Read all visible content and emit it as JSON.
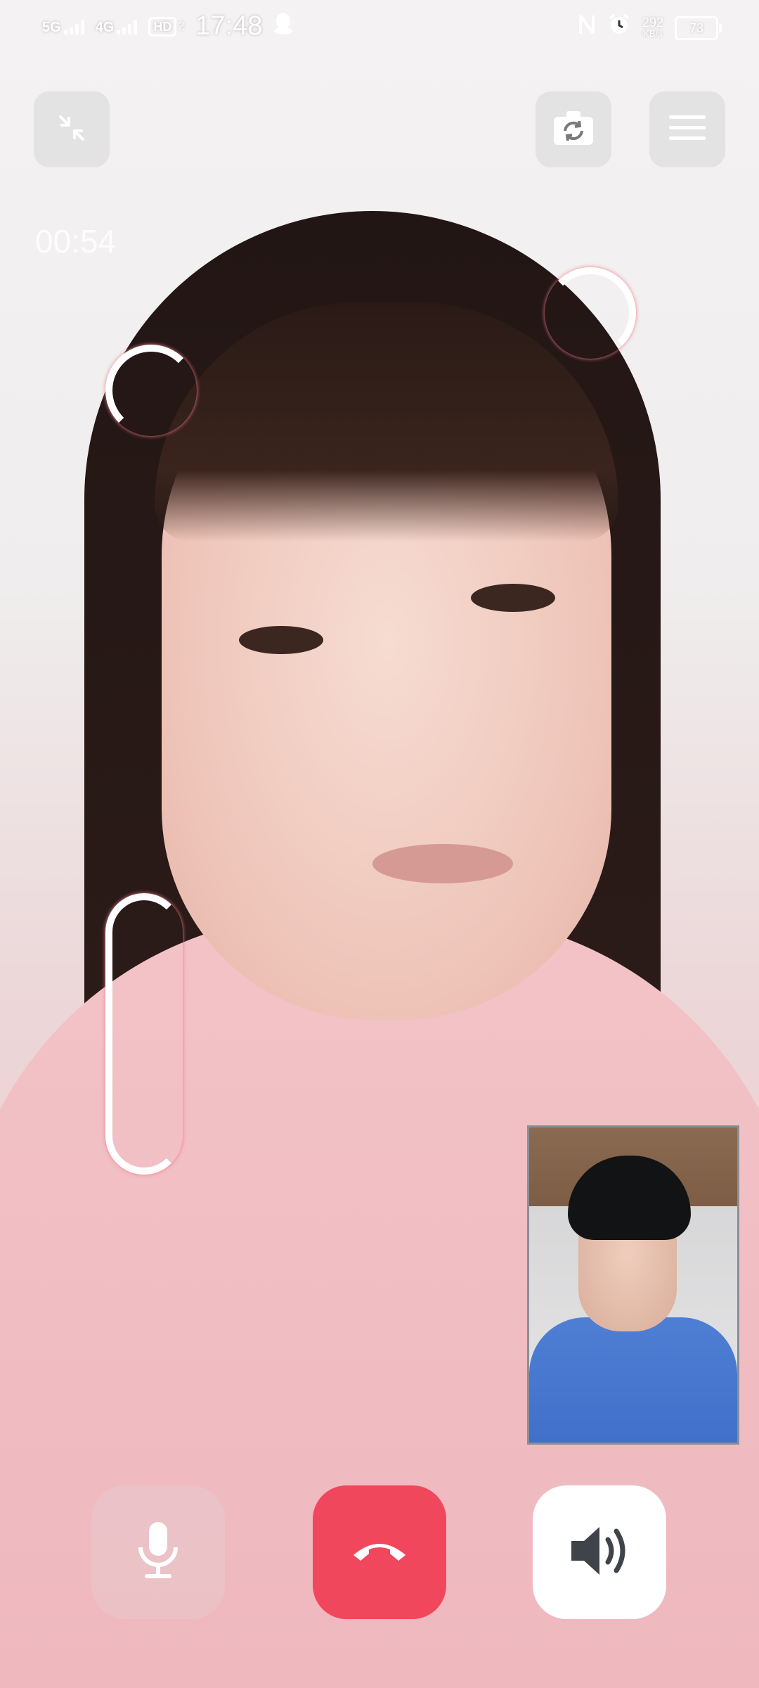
{
  "status_bar": {
    "network_1": "5G",
    "network_2": "4G",
    "hd_label": "HD",
    "hd_sub": "2",
    "time": "17:48",
    "speed_value": "292",
    "speed_unit": "KB/s",
    "battery": "73"
  },
  "call": {
    "duration": "00:54"
  },
  "icons": {
    "collapse": "collapse-arrows-icon",
    "switch_camera": "switch-camera-icon",
    "menu": "hamburger-menu-icon",
    "mute": "microphone-icon",
    "hangup": "phone-hangup-icon",
    "speaker": "speaker-icon"
  },
  "colors": {
    "hangup": "#f0475c",
    "speaker_bg": "#ffffff",
    "icon_gray": "#3f444b"
  }
}
